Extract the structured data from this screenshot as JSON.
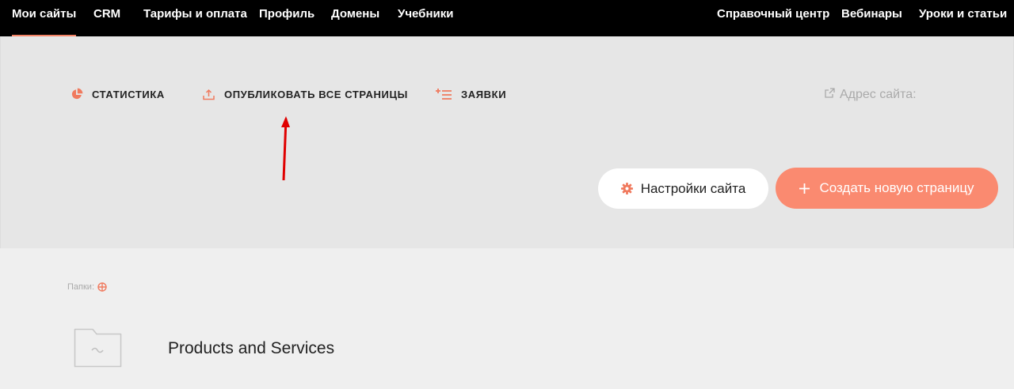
{
  "nav": {
    "left": [
      "Мои сайты",
      "CRM",
      "Тарифы и оплата",
      "Профиль",
      "Домены",
      "Учебники"
    ],
    "right": [
      "Справочный центр",
      "Вебинары",
      "Уроки и статьи"
    ]
  },
  "actions": {
    "statistics": "СТАТИСТИКА",
    "publish_all": "ОПУБЛИКОВАТЬ ВСЕ СТРАНИЦЫ",
    "requests": "ЗАЯВКИ"
  },
  "site_address_label": "Адрес сайта:",
  "buttons": {
    "site_settings": "Настройки сайта",
    "create_page": "Создать новую страницу"
  },
  "folders_label": "Папки:",
  "project": {
    "title": "Products and Services"
  },
  "colors": {
    "accent": "#fa8a70",
    "nav_bg": "#000000",
    "arrow": "#e00000"
  }
}
